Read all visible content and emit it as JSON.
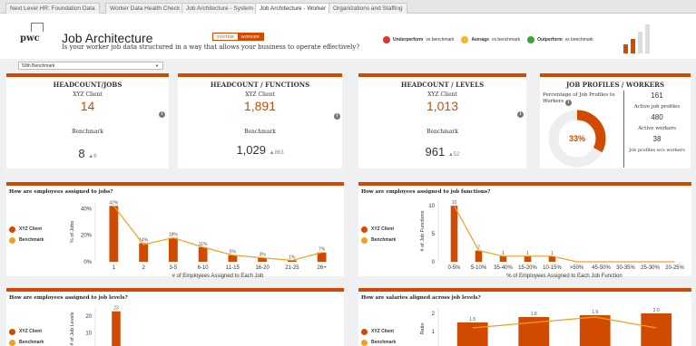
{
  "tabs": [
    {
      "label": "Next Level HR: Foundation Data",
      "active": false
    },
    {
      "label": "Worker Data Health Check",
      "active": false
    },
    {
      "label": "Job Architecture - System",
      "active": false
    },
    {
      "label": "Job Architecture - Worker",
      "active": true
    },
    {
      "label": "Organizations and Staffing",
      "active": false
    }
  ],
  "header": {
    "logo_text": "pwc",
    "title": "Job Architecture",
    "subtitle": "Is your worker job data structured in a way that allows your business to operate effectively?",
    "toggle": {
      "system": "SYSTEM",
      "worker": "WORKER"
    },
    "legend": [
      {
        "label": "Underperform",
        "suffix": "vs benchmark",
        "color": "#d9382a"
      },
      {
        "label": "Average",
        "suffix": "vs benchmark",
        "color": "#f5b81d"
      },
      {
        "label": "Outperform",
        "suffix": "vs benchmark",
        "color": "#3aa63a"
      }
    ]
  },
  "benchmark_select": {
    "value": "50th Benchmark"
  },
  "colors": {
    "accent": "#d04a02",
    "benchmark_line": "#f0a020",
    "bar": "#d04a02"
  },
  "kpis": {
    "jobs": {
      "title": "HEADCOUNT/JOBS",
      "client_label": "XYZ Client",
      "client_value": "14",
      "bench_label": "Benchmark",
      "bench_value": "8",
      "bench_delta": "▲6"
    },
    "functions": {
      "title": "HEADCOUNT / FUNCTIONS",
      "client_label": "XYZ Client",
      "client_value": "1,891",
      "bench_label": "Benchmark",
      "bench_value": "1,029",
      "bench_delta": "▲863"
    },
    "levels": {
      "title": "HEADCOUNT / LEVELS",
      "client_label": "XYZ Client",
      "client_value": "1,013",
      "bench_label": "Benchmark",
      "bench_value": "961",
      "bench_delta": "▲52"
    },
    "profiles": {
      "title": "JOB PROFILES / WORKERS",
      "pct_label": "Percentage of Job Profiles to Workers",
      "pct_value": "33%",
      "pct": 0.33,
      "stats": [
        {
          "value": "161",
          "label": "Active job profiles"
        },
        {
          "value": "480",
          "label": "Active workers"
        },
        {
          "value": "38",
          "label": "Job profiles w/o workers"
        }
      ]
    }
  },
  "panels": {
    "jobs": {
      "title": "How are employees assigned to jobs?",
      "xlabel": "# of Employees Assigned to Each Job",
      "ylabel": "% of Jobs",
      "legend": [
        "XYZ Client",
        "Benchmark"
      ]
    },
    "functions": {
      "title": "How are employees assigned to job functions?",
      "xlabel": "% of Employees Assigned to Each Job Function",
      "ylabel": "# of Job Functions",
      "legend": [
        "XYZ Client",
        "Benchmark"
      ]
    },
    "levels": {
      "title": "How are employees assigned to job levels?",
      "ylabel": "# of Job Levels",
      "legend": [
        "XYZ Client",
        "Benchmark"
      ]
    },
    "salaries": {
      "title": "How are salaries aligned across job levels?",
      "ylabel": "Ratio",
      "legend": [
        "XYZ Client",
        "Benchmark"
      ]
    }
  },
  "chart_data": [
    {
      "id": "jobs",
      "type": "bar",
      "categories": [
        "1",
        "2",
        "3-5",
        "6-10",
        "11-15",
        "16-20",
        "21-25",
        "26+"
      ],
      "series": [
        {
          "name": "XYZ Client",
          "values": [
            42,
            14,
            18,
            11,
            5,
            3,
            1,
            7
          ]
        },
        {
          "name": "Benchmark",
          "values": [
            42,
            13,
            18,
            11,
            5,
            3,
            1,
            7
          ]
        }
      ],
      "data_labels": [
        "42%",
        "14%",
        "18%",
        "11%",
        "5%",
        "3%",
        "1%",
        "7%"
      ],
      "yticks": [
        "0%",
        "20%",
        "40%"
      ],
      "ylim": [
        0,
        45
      ]
    },
    {
      "id": "functions",
      "type": "bar",
      "categories": [
        "0-5%",
        "5-10%",
        "35-40%",
        "15-20%",
        "10-15%",
        ">50%",
        "45-50%",
        "30-35%",
        "25-30%",
        "20-25%"
      ],
      "series": [
        {
          "name": "XYZ Client",
          "values": [
            10,
            2,
            1,
            1,
            1,
            0,
            0,
            0,
            0,
            0
          ]
        },
        {
          "name": "Benchmark",
          "values": [
            10,
            2,
            1,
            1,
            1,
            0,
            0,
            0,
            0,
            0
          ]
        }
      ],
      "data_labels": [
        "10",
        "2",
        "1",
        "1",
        "1",
        "",
        "",
        "",
        "",
        ""
      ],
      "yticks": [
        "0",
        "5",
        "10"
      ],
      "ylim": [
        0,
        11
      ]
    },
    {
      "id": "levels",
      "type": "bar",
      "categories": [
        "1"
      ],
      "series": [
        {
          "name": "XYZ Client",
          "values": [
            23
          ]
        }
      ],
      "data_labels": [
        "23"
      ],
      "yticks": [
        "10",
        "20"
      ],
      "ylim": [
        0,
        25
      ]
    },
    {
      "id": "salaries",
      "type": "bar",
      "categories": [
        "1",
        "2",
        "3",
        "4"
      ],
      "series": [
        {
          "name": "XYZ Client",
          "values": [
            1.5,
            1.8,
            1.9,
            2.0
          ]
        },
        {
          "name": "Benchmark",
          "values": [
            1.2,
            1.5,
            1.8,
            1.2
          ]
        }
      ],
      "data_labels": [
        "1.5",
        "1.8",
        "1.9",
        "2.0"
      ],
      "yticks": [
        "1",
        "2"
      ],
      "ylim": [
        0,
        2.3
      ]
    }
  ]
}
